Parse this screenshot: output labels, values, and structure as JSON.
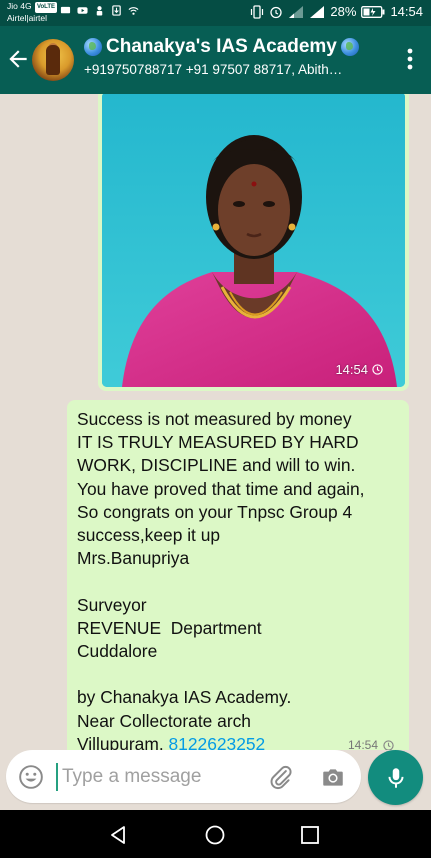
{
  "status_bar": {
    "carrier_line1": "Jio 4G",
    "volte_badge": "VoLTE",
    "carrier_line2": "Airtel|airtel",
    "battery": "28%",
    "time": "14:54"
  },
  "header": {
    "title": "Chanakya's IAS Academy",
    "subtitle": "+919750788717 +91 97507 88717, Abith…"
  },
  "messages": {
    "image_time": "14:54",
    "text_body": "Success is not measured by money\nIT IS TRULY MEASURED BY HARD WORK, DISCIPLINE and will to win.\nYou have proved that time and again,\nSo congrats on your Tnpsc Group 4 success,keep it up\nMrs.Banupriya\n\nSurveyor\nREVENUE  Department\nCuddalore\n\nby Chanakya IAS Academy.\nNear Collectorate arch\nVillupuram. ",
    "phone_link": "8122623252",
    "text_time": "14:54"
  },
  "composer": {
    "placeholder": "Type a message"
  },
  "colors": {
    "header_bg": "#075e54",
    "status_bg": "#054d44",
    "bubble_out": "#dcf8c6",
    "accent": "#128c7e",
    "link": "#039be5"
  },
  "icons": {
    "back": "arrow-left-icon",
    "menu": "more-vert-icon",
    "emoji": "emoji-icon",
    "attach": "paperclip-icon",
    "camera": "camera-icon",
    "mic": "mic-icon"
  }
}
